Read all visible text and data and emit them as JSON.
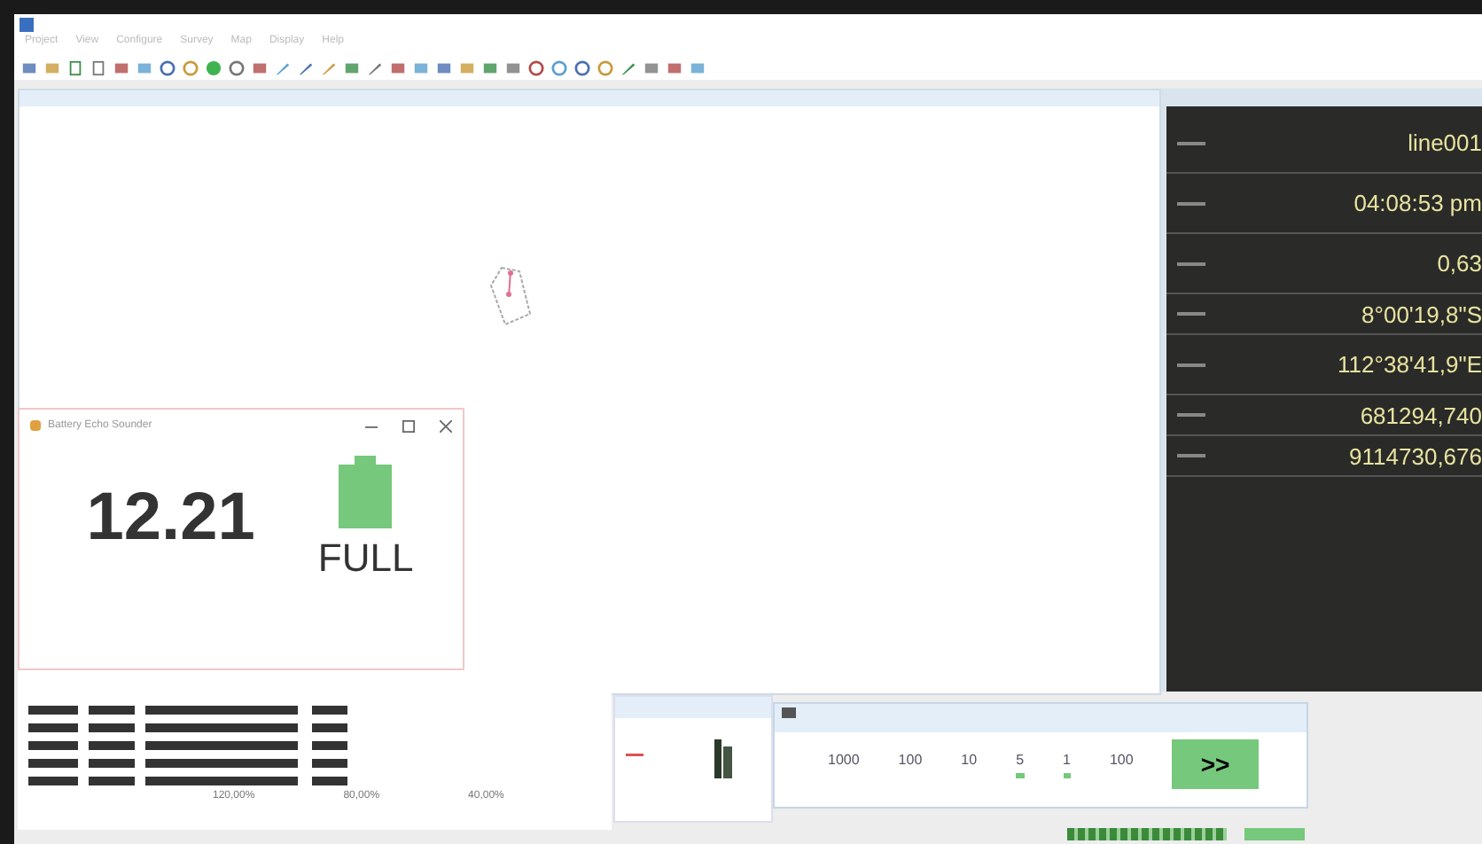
{
  "menu": [
    {
      "label": "Project"
    },
    {
      "label": "View"
    },
    {
      "label": "Configure"
    },
    {
      "label": "Survey"
    },
    {
      "label": "Map"
    },
    {
      "label": "Display"
    },
    {
      "label": "Help"
    }
  ],
  "battery_window": {
    "title": "Battery Echo Sounder",
    "voltage": "12.21",
    "status": "FULL"
  },
  "readout_panel": {
    "rows": [
      {
        "value": "line001",
        "gap_after": true
      },
      {
        "value": "04:08:53 pm",
        "gap_after": true
      },
      {
        "value": "0,63",
        "gap_after": true
      },
      {
        "value": "8°00'19,8\"S",
        "gap_after": false
      },
      {
        "value": "112°38'41,9\"E",
        "gap_after": true
      },
      {
        "value": "681294,740",
        "gap_after": false
      },
      {
        "value": "9114730,676",
        "gap_after": false
      }
    ]
  },
  "scale_labels": [
    "120,00%",
    "80,00%",
    "40,00%"
  ],
  "speed_window": {
    "steps": [
      {
        "label": "1000",
        "selected": false
      },
      {
        "label": "100",
        "selected": false
      },
      {
        "label": "10",
        "selected": false
      },
      {
        "label": "5",
        "selected": true
      },
      {
        "label": "1",
        "selected": true
      },
      {
        "label": "100",
        "selected": false
      }
    ],
    "button": ">>"
  }
}
